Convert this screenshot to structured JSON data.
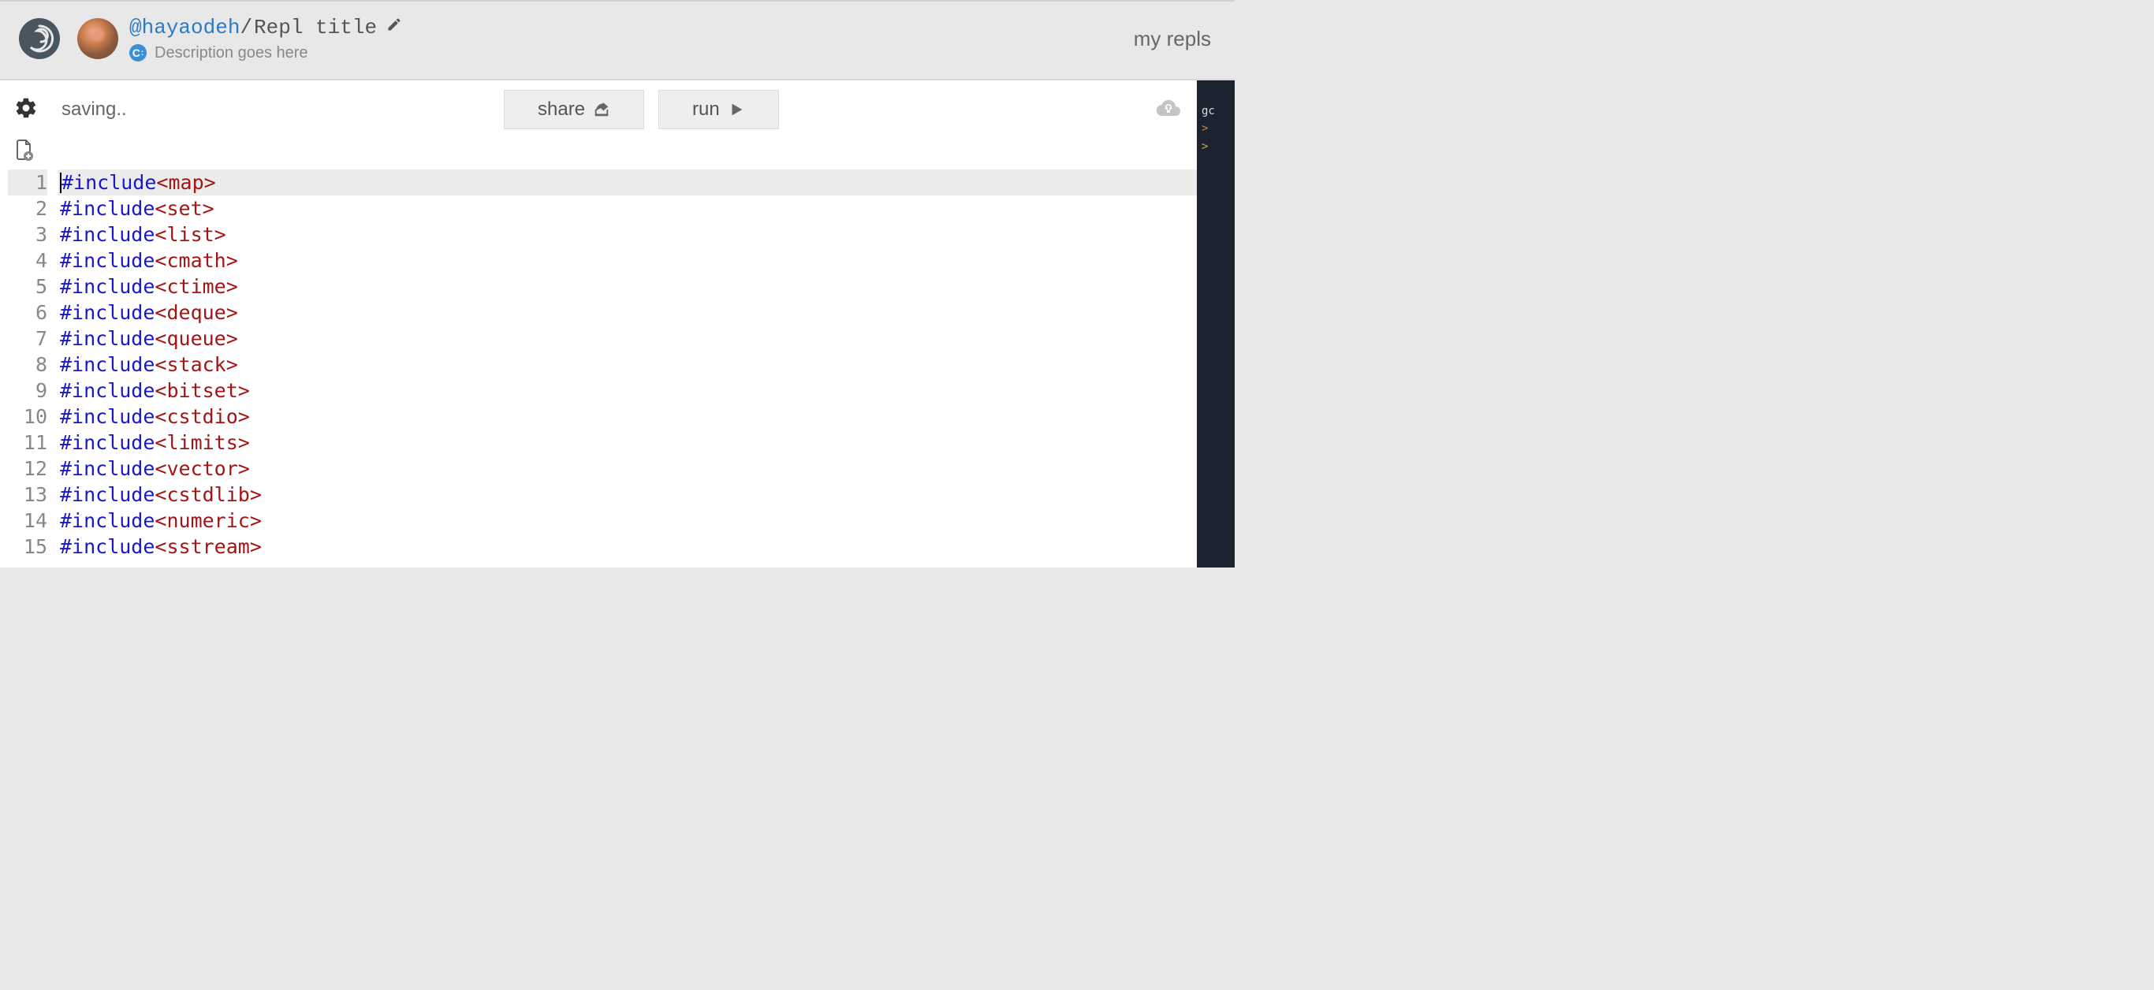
{
  "header": {
    "username": "@hayaodeh",
    "separator": "/",
    "repl_title": "Repl title",
    "description": "Description goes here",
    "my_repls_label": "my repls",
    "lang_icon_name": "cpp-icon"
  },
  "toolbar": {
    "status": "saving..",
    "share_label": "share",
    "run_label": "run"
  },
  "editor": {
    "active_line": 1,
    "lines": [
      {
        "keyword": "#include",
        "value": "<map>"
      },
      {
        "keyword": "#include",
        "value": "<set>"
      },
      {
        "keyword": "#include",
        "value": "<list>"
      },
      {
        "keyword": "#include",
        "value": "<cmath>"
      },
      {
        "keyword": "#include",
        "value": "<ctime>"
      },
      {
        "keyword": "#include",
        "value": "<deque>"
      },
      {
        "keyword": "#include",
        "value": "<queue>"
      },
      {
        "keyword": "#include",
        "value": "<stack>"
      },
      {
        "keyword": "#include",
        "value": "<bitset>"
      },
      {
        "keyword": "#include",
        "value": "<cstdio>"
      },
      {
        "keyword": "#include",
        "value": "<limits>"
      },
      {
        "keyword": "#include",
        "value": "<vector>"
      },
      {
        "keyword": "#include",
        "value": "<cstdlib>"
      },
      {
        "keyword": "#include",
        "value": "<numeric>"
      },
      {
        "keyword": "#include",
        "value": "<sstream>"
      }
    ]
  },
  "console": {
    "first_line": "gc",
    "prompt1": ">",
    "prompt2": ">"
  }
}
